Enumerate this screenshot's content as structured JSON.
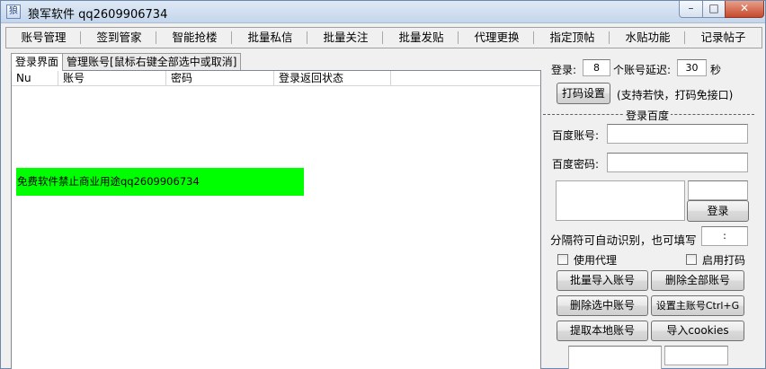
{
  "titlebar": {
    "icon": "wolf-app-icon",
    "title": "狼军软件 qq2609906734",
    "min": "–",
    "max": "□",
    "close": "✕"
  },
  "menu": [
    "账号管理",
    "签到管家",
    "智能抢楼",
    "批量私信",
    "批量关注",
    "批量发贴",
    "代理更换",
    "指定顶帖",
    "水贴功能",
    "记录帖子"
  ],
  "tabs": [
    "登录界面",
    "管理账号[鼠标右键全部选中或取消]"
  ],
  "table": {
    "columns": [
      "Nu",
      "账号",
      "密码",
      "登录返回状态"
    ]
  },
  "notice": "免费软件禁止商业用途qq2609906734",
  "login": {
    "login_label": "登录:",
    "login_count": "8",
    "delay_label": "个账号延迟:",
    "delay_value": "30",
    "seconds": "秒",
    "captcha_button": "打码设置",
    "captcha_note": "(支持若快，打码免接口)"
  },
  "baidu": {
    "group_title": "登录百度",
    "account_label": "百度账号:",
    "account_value": "",
    "password_label": "百度密码:",
    "password_value": "",
    "login_button": "登录",
    "separator_label": "分隔符可自动识别，也可填写",
    "separator_value": ":"
  },
  "options": {
    "proxy_label": "使用代理",
    "captcha_label": "启用打码"
  },
  "buttons": {
    "batch_import": "批量导入账号",
    "delete_all": "删除全部账号",
    "delete_selected": "删除选中账号",
    "set_main": "设置主账号Ctrl+G",
    "fetch_local": "提取本地账号",
    "import_cookies": "导入cookies"
  }
}
